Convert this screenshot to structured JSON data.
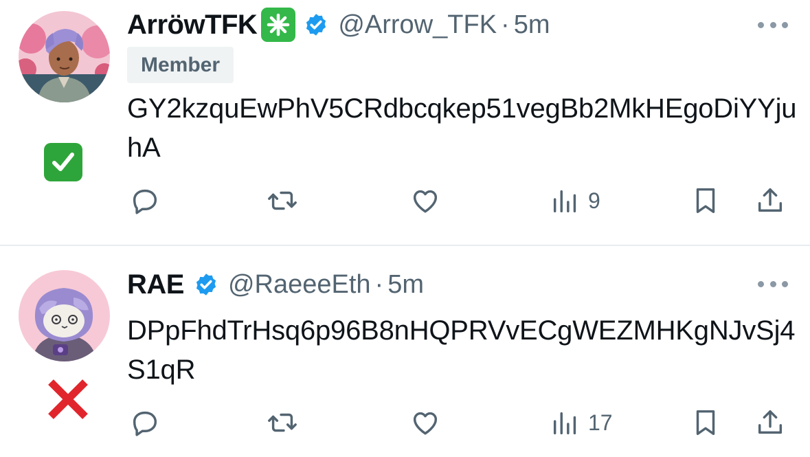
{
  "tweets": [
    {
      "display_name": "ArröwTFK",
      "handle": "@Arrow_TFK",
      "separator": "·",
      "time": "5m",
      "badge": "Member",
      "text": "GY2kzquEwPhV5CRdbcqkep51vegBb2MkHEgoDiYYjuhA",
      "views": "9",
      "side_mark": "green-checkmark",
      "icons": [
        "sparkle-badge",
        "verified-badge",
        "more-dots",
        "reply",
        "retweet",
        "like",
        "views",
        "bookmark",
        "share"
      ]
    },
    {
      "display_name": "RAE",
      "handle": "@RaeeeEth",
      "separator": "·",
      "time": "5m",
      "text": "DPpFhdTrHsq6p96B8nHQPRVvECgWEZMHKgNJvSj4S1qR",
      "views": "17",
      "side_mark": "red-cross",
      "icons": [
        "verified-badge",
        "more-dots",
        "reply",
        "retweet",
        "like",
        "views",
        "bookmark",
        "share"
      ]
    }
  ],
  "colors": {
    "verified": "#1d9bf0",
    "check_green": "#2ea53a",
    "cross_red": "#e0262c",
    "muted": "#536471"
  }
}
